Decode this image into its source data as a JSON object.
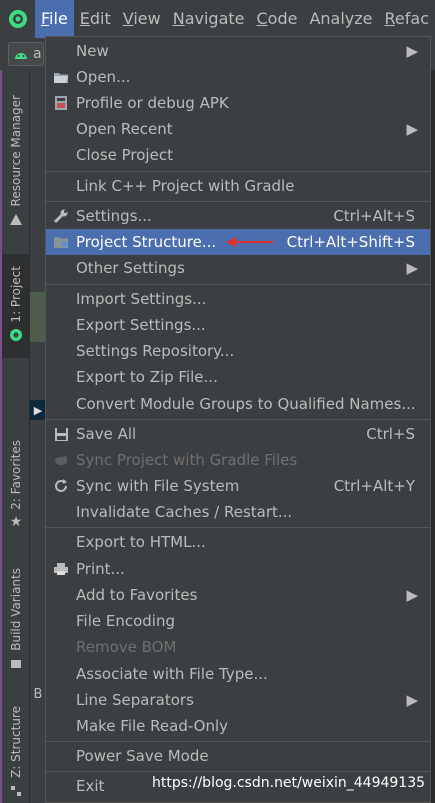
{
  "menubar": {
    "items": [
      {
        "mnemonic": "F",
        "rest": "ile"
      },
      {
        "mnemonic": "E",
        "rest": "dit"
      },
      {
        "mnemonic": "V",
        "rest": "iew"
      },
      {
        "mnemonic": "N",
        "rest": "avigate"
      },
      {
        "mnemonic": "C",
        "rest": "ode"
      },
      {
        "label": "Analyze"
      },
      {
        "mnemonic": "R",
        "rest": "efac"
      }
    ]
  },
  "toolbar": {
    "config_text": "a"
  },
  "left_strip": {
    "resource_manager": "Resource Manager",
    "project": "1: Project",
    "favorites": "2: Favorites",
    "build_variants": "Build Variants",
    "structure": "Z: Structure"
  },
  "editor": {
    "bottom_tab": "B",
    "arrow": "▶"
  },
  "file_menu": {
    "items": [
      {
        "label": "New",
        "submenu": true
      },
      {
        "label": "Open...",
        "icon": "folder-icon"
      },
      {
        "label": "Profile or debug APK",
        "icon": "apk-icon"
      },
      {
        "label": "Open Recent",
        "submenu": true
      },
      {
        "label": "Close Project"
      },
      {
        "label": "Link C++ Project with Gradle"
      },
      {
        "label": "Settings...",
        "icon": "wrench-icon",
        "shortcut": "Ctrl+Alt+S"
      },
      {
        "label": "Project Structure...",
        "icon": "project-structure-icon",
        "shortcut": "Ctrl+Alt+Shift+S",
        "selected": true
      },
      {
        "label": "Other Settings",
        "submenu": true
      },
      {
        "label": "Import Settings..."
      },
      {
        "label": "Export Settings..."
      },
      {
        "label": "Settings Repository..."
      },
      {
        "label": "Export to Zip File..."
      },
      {
        "label": "Convert Module Groups to Qualified Names..."
      },
      {
        "label": "Save All",
        "icon": "save-icon",
        "shortcut": "Ctrl+S"
      },
      {
        "label": "Sync Project with Gradle Files",
        "icon": "gradle-sync-icon",
        "disabled": true
      },
      {
        "label": "Sync with File System",
        "icon": "refresh-icon",
        "shortcut": "Ctrl+Alt+Y"
      },
      {
        "label": "Invalidate Caches / Restart..."
      },
      {
        "label": "Export to HTML..."
      },
      {
        "label": "Print...",
        "icon": "print-icon"
      },
      {
        "label": "Add to Favorites",
        "submenu": true
      },
      {
        "label": "File Encoding"
      },
      {
        "label": "Remove BOM",
        "disabled": true
      },
      {
        "label": "Associate with File Type..."
      },
      {
        "label": "Line Separators",
        "submenu": true
      },
      {
        "label": "Make File Read-Only"
      },
      {
        "label": "Power Save Mode"
      },
      {
        "label": "Exit"
      }
    ]
  },
  "watermark": "https://blog.csdn.net/weixin_44949135",
  "colors": {
    "accent": "#4b6eaf",
    "menu_bg": "#3c3f41",
    "annotation_arrow": "#e03030"
  }
}
